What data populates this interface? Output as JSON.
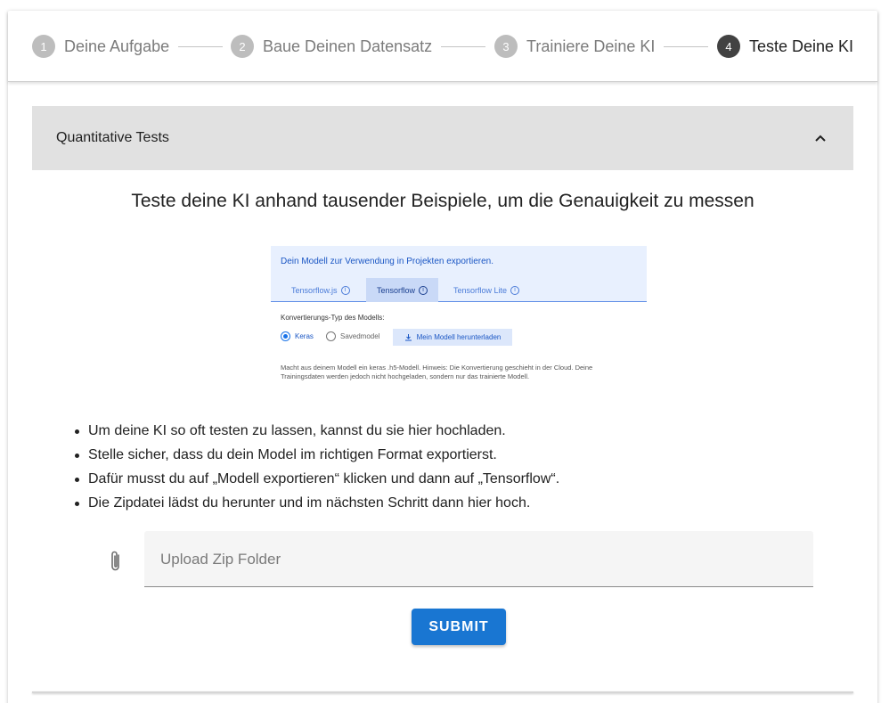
{
  "stepper": {
    "steps": [
      {
        "number": "1",
        "label": "Deine Aufgabe"
      },
      {
        "number": "2",
        "label": "Baue Deinen Datensatz"
      },
      {
        "number": "3",
        "label": "Trainiere Deine KI"
      },
      {
        "number": "4",
        "label": "Teste Deine KI"
      }
    ],
    "active_step": 4
  },
  "panel": {
    "title": "Quantitative Tests",
    "headline": "Teste deine KI anhand tausender Beispiele, um die Genauigkeit zu messen",
    "screenshot": {
      "title": "Dein Modell zur Verwendung in Projekten exportieren.",
      "tabs": [
        "Tensorflow.js",
        "Tensorflow",
        "Tensorflow Lite"
      ],
      "active_tab": "Tensorflow",
      "label": "Konvertierungs-Typ des Modells:",
      "options": [
        "Keras",
        "Savedmodel"
      ],
      "selected_option": "Keras",
      "download_button": "Mein Modell herunterladen",
      "note": "Macht aus deinem Modell ein keras .h5-Modell. Hinweis: Die Konvertierung geschieht in der Cloud. Deine Trainingsdaten werden jedoch nicht hochgeladen, sondern nur das trainierte Modell."
    },
    "bullets": [
      "Um deine KI so oft testen zu lassen, kannst du sie hier hochladen.",
      "Stelle sicher, dass du dein Model im richtigen Format exportierst.",
      "Dafür musst du auf „Modell exportieren“ klicken und dann auf „Tensorflow“.",
      "Die Zipdatei lädst du herunter und im nächsten Schritt dann hier hoch."
    ],
    "upload": {
      "placeholder": "Upload Zip Folder",
      "value": ""
    },
    "submit_label": "SUBMIT"
  },
  "colors": {
    "primary": "#1976d2",
    "header_bg": "#e1e1e1",
    "step_active": "#424242",
    "step_inactive": "#bdbdbd"
  },
  "icons": [
    "chevron-up-icon",
    "paperclip-icon",
    "download-icon",
    "info-icon"
  ]
}
